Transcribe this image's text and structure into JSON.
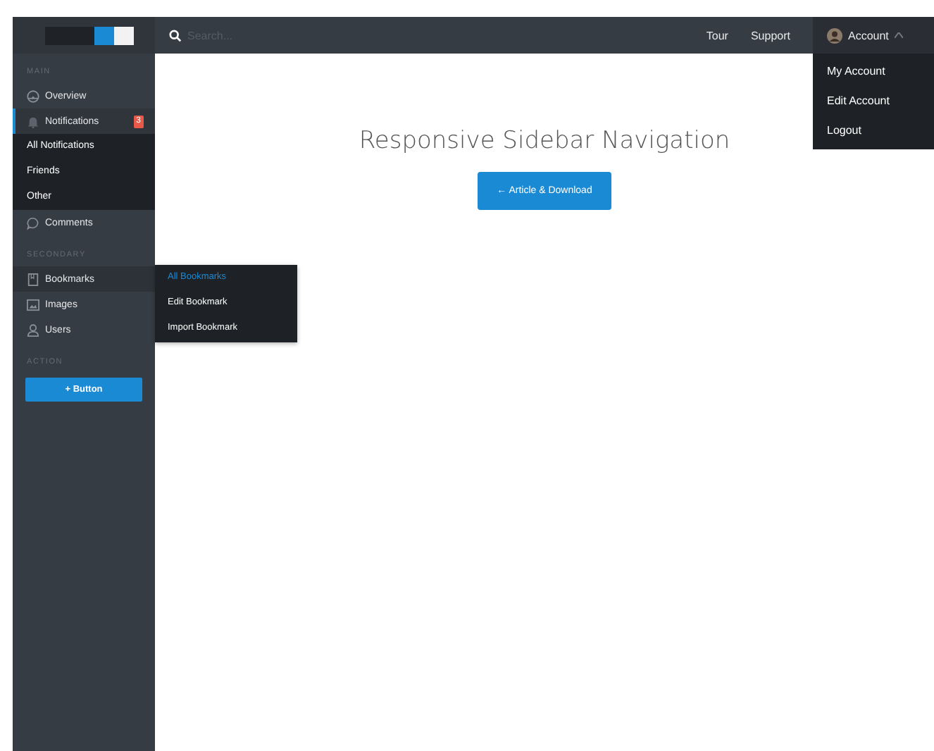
{
  "topbar": {
    "search": {
      "placeholder": "Search..."
    },
    "links": [
      "Tour",
      "Support"
    ],
    "account": {
      "label": "Account",
      "open": true,
      "menu": [
        "My Account",
        "Edit Account",
        "Logout"
      ]
    }
  },
  "sidebar": {
    "sections": [
      {
        "title": "MAIN",
        "items": [
          {
            "label": "Overview",
            "selected": false
          },
          {
            "label": "Notifications",
            "selected": true,
            "badge": "3",
            "expanded": true,
            "children": [
              {
                "label": "All Notifications"
              },
              {
                "label": "Friends"
              },
              {
                "label": "Other"
              }
            ]
          },
          {
            "label": "Comments",
            "selected": false
          }
        ]
      },
      {
        "title": "SECONDARY",
        "items": [
          {
            "label": "Bookmarks",
            "selected": false,
            "hovered": true,
            "flyout": [
              {
                "label": "All Bookmarks",
                "selected": true
              },
              {
                "label": "Edit Bookmark",
                "selected": false
              },
              {
                "label": "Import Bookmark",
                "selected": false
              }
            ]
          },
          {
            "label": "Images",
            "selected": false
          },
          {
            "label": "Users",
            "selected": false
          }
        ]
      },
      {
        "title": "ACTION",
        "button": "+ Button"
      }
    ]
  },
  "main": {
    "title": "Responsive Sidebar Navigation",
    "button": "← Article & Download"
  }
}
